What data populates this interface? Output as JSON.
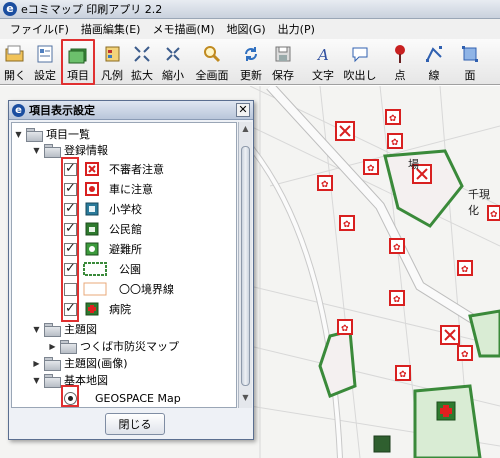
{
  "app": {
    "title": "eコミマップ 印刷アプリ 2.2",
    "logo": "e"
  },
  "menu": [
    {
      "label": "ファイル(F)"
    },
    {
      "label": "描画編集(E)"
    },
    {
      "label": "メモ描画(M)"
    },
    {
      "label": "地図(G)"
    },
    {
      "label": "出力(P)"
    }
  ],
  "toolbar": [
    {
      "label": "開く",
      "icon": "open-folder-icon"
    },
    {
      "label": "設定",
      "icon": "settings-icon"
    },
    {
      "label": "項目",
      "icon": "layers-icon",
      "active": true
    },
    {
      "label": "凡例",
      "icon": "legend-icon"
    },
    {
      "label": "拡大",
      "icon": "zoom-in-icon"
    },
    {
      "label": "縮小",
      "icon": "zoom-out-icon"
    },
    {
      "label": "全画面",
      "icon": "full-extent-icon"
    },
    {
      "label": "更新",
      "icon": "refresh-icon"
    },
    {
      "label": "保存",
      "icon": "save-icon"
    },
    {
      "label": "文字",
      "icon": "text-icon"
    },
    {
      "label": "吹出し",
      "icon": "balloon-icon"
    },
    {
      "label": "点",
      "icon": "pin-icon"
    },
    {
      "label": "線",
      "icon": "line-icon"
    },
    {
      "label": "面",
      "icon": "polygon-icon"
    }
  ],
  "map": {
    "place_label": "千現化",
    "station_text": "場"
  },
  "dialog": {
    "logo": "e",
    "title": "項目表示設定",
    "close_glyph": "✕",
    "close_button": "閉じる",
    "tree": {
      "root": "項目一覧",
      "group1": "登録情報",
      "items": [
        {
          "label": "不審者注意",
          "checked": true,
          "symbol": "cross-box"
        },
        {
          "label": "車に注意",
          "checked": true,
          "symbol": "car-box"
        },
        {
          "label": "小学校",
          "checked": true,
          "symbol": "school-box"
        },
        {
          "label": "公民館",
          "checked": true,
          "symbol": "hall-box"
        },
        {
          "label": "避難所",
          "checked": true,
          "symbol": "shelter-box"
        },
        {
          "label": "公園",
          "checked": true,
          "symbol": "park-area"
        },
        {
          "label": "〇〇境界線",
          "checked": false,
          "symbol": "boundary-line"
        },
        {
          "label": "病院",
          "checked": true,
          "symbol": "hospital-box"
        }
      ],
      "theme_group": "主題図",
      "theme_child": "つくば市防災マップ",
      "theme_image": "主題図(画像)",
      "base_group": "基本地図",
      "base_map": "GEOSPACE Map"
    }
  },
  "colors": {
    "accent_red": "#e03030",
    "park_green": "#3a8a3a",
    "marker_red": "#d82020"
  }
}
